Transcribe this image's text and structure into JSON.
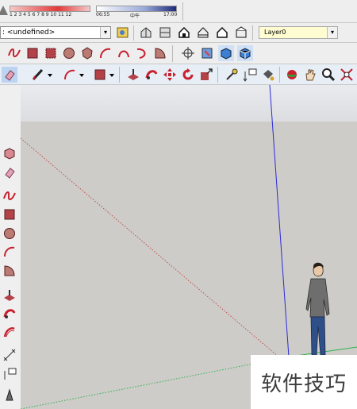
{
  "shadow_settings": {
    "months": "1 2 3 4 5 6 7 8 9 10 11 12",
    "time_start": "06:55",
    "time_noon": "中午",
    "time_end": "17:00"
  },
  "styles": {
    "label": ":",
    "current_style": "<undefined>"
  },
  "layers": {
    "current_layer": "Layer0"
  },
  "watermark": {
    "text": "软件技巧"
  },
  "colors": {
    "toolbar_bg": "#eeeeee",
    "layer_highlight": "#fffcd1",
    "axis_blue": "#2b2bd6",
    "axis_red": "#c0504d",
    "axis_green": "#2fb34a",
    "drawing_red": "#c8202e"
  }
}
